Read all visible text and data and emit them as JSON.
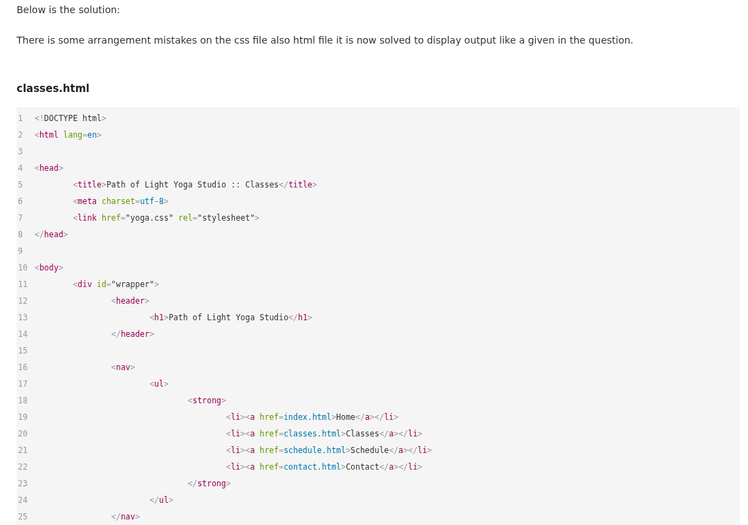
{
  "intro": "Below is the solution:",
  "explanation": "There is some arrangement mistakes on the css file also html file it is now solved to display output like a given in the question.",
  "file_heading": "classes.html",
  "code": {
    "lines": [
      {
        "number": "1",
        "text": "<!DOCTYPE html>"
      },
      {
        "number": "2",
        "text": "<html lang=en>"
      },
      {
        "number": "3"
      },
      {
        "number": "4",
        "text": "<head>"
      },
      {
        "number": "5",
        "text": "\t<title>Path of Light Yoga Studio :: Classes</title>"
      },
      {
        "number": "6",
        "text": "\t<meta charset=utf-8>"
      },
      {
        "number": "7",
        "text": "\t<link href=\"yoga.css\" rel=\"stylesheet\">"
      },
      {
        "number": "8",
        "text": "</head>"
      },
      {
        "number": "9"
      },
      {
        "number": "10",
        "text": "<body>"
      },
      {
        "number": "11",
        "text": "\t<div id=\"wrapper\">"
      },
      {
        "number": "12",
        "text": "\t\t<header>"
      },
      {
        "number": "13",
        "text": "\t\t\t<h1>Path of Light Yoga Studio</h1>"
      },
      {
        "number": "14",
        "text": "\t\t</header>"
      },
      {
        "number": "15"
      },
      {
        "number": "16",
        "text": "\t\t<nav>"
      },
      {
        "number": "17",
        "text": "\t\t\t<ul>"
      },
      {
        "number": "18",
        "text": "\t\t\t\t<strong>"
      },
      {
        "number": "19",
        "text": "\t\t\t\t\t<li><a href=index.html>Home</a></li>"
      },
      {
        "number": "20",
        "text": "\t\t\t\t\t<li><a href=classes.html>Classes</a></li>"
      },
      {
        "number": "21",
        "text": "\t\t\t\t\t<li><a href=schedule.html>Schedule</a></li>"
      },
      {
        "number": "22",
        "text": "\t\t\t\t\t<li><a href=contact.html>Contact</a></li>"
      },
      {
        "number": "23",
        "text": "\t\t\t\t</strong>"
      },
      {
        "number": "24",
        "text": "\t\t\t</ul>"
      },
      {
        "number": "25",
        "text": "\t\t</nav>"
      }
    ]
  }
}
